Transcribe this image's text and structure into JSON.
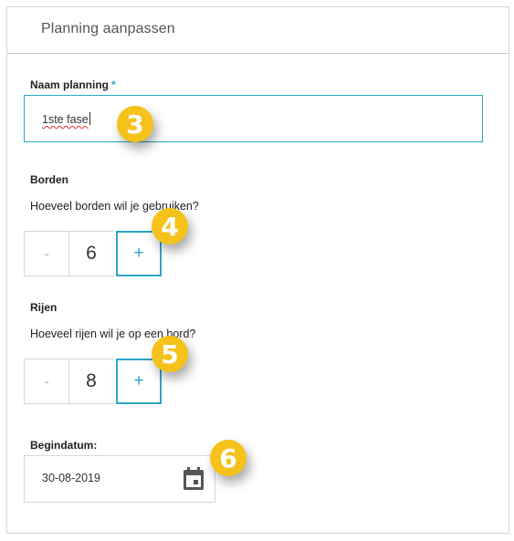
{
  "panel": {
    "title": "Planning aanpassen"
  },
  "name_field": {
    "label": "Naam planning",
    "required_mark": "*",
    "value": "1ste fase"
  },
  "borden": {
    "label": "Borden",
    "question": "Hoeveel borden wil je gebruiken?",
    "decrement_label": "-",
    "value": "6",
    "increment_label": "+"
  },
  "rijen": {
    "label": "Rijen",
    "question": "Hoeveel rijen wil je op een bord?",
    "decrement_label": "-",
    "value": "8",
    "increment_label": "+"
  },
  "begindatum": {
    "label": "Begindatum:",
    "value": "30-08-2019",
    "icon": "calendar-icon"
  },
  "callouts": [
    "3",
    "4",
    "5",
    "6"
  ],
  "colors": {
    "accent": "#2aa6c5",
    "callout": "#f5c21b",
    "border": "#d6d6d6"
  }
}
